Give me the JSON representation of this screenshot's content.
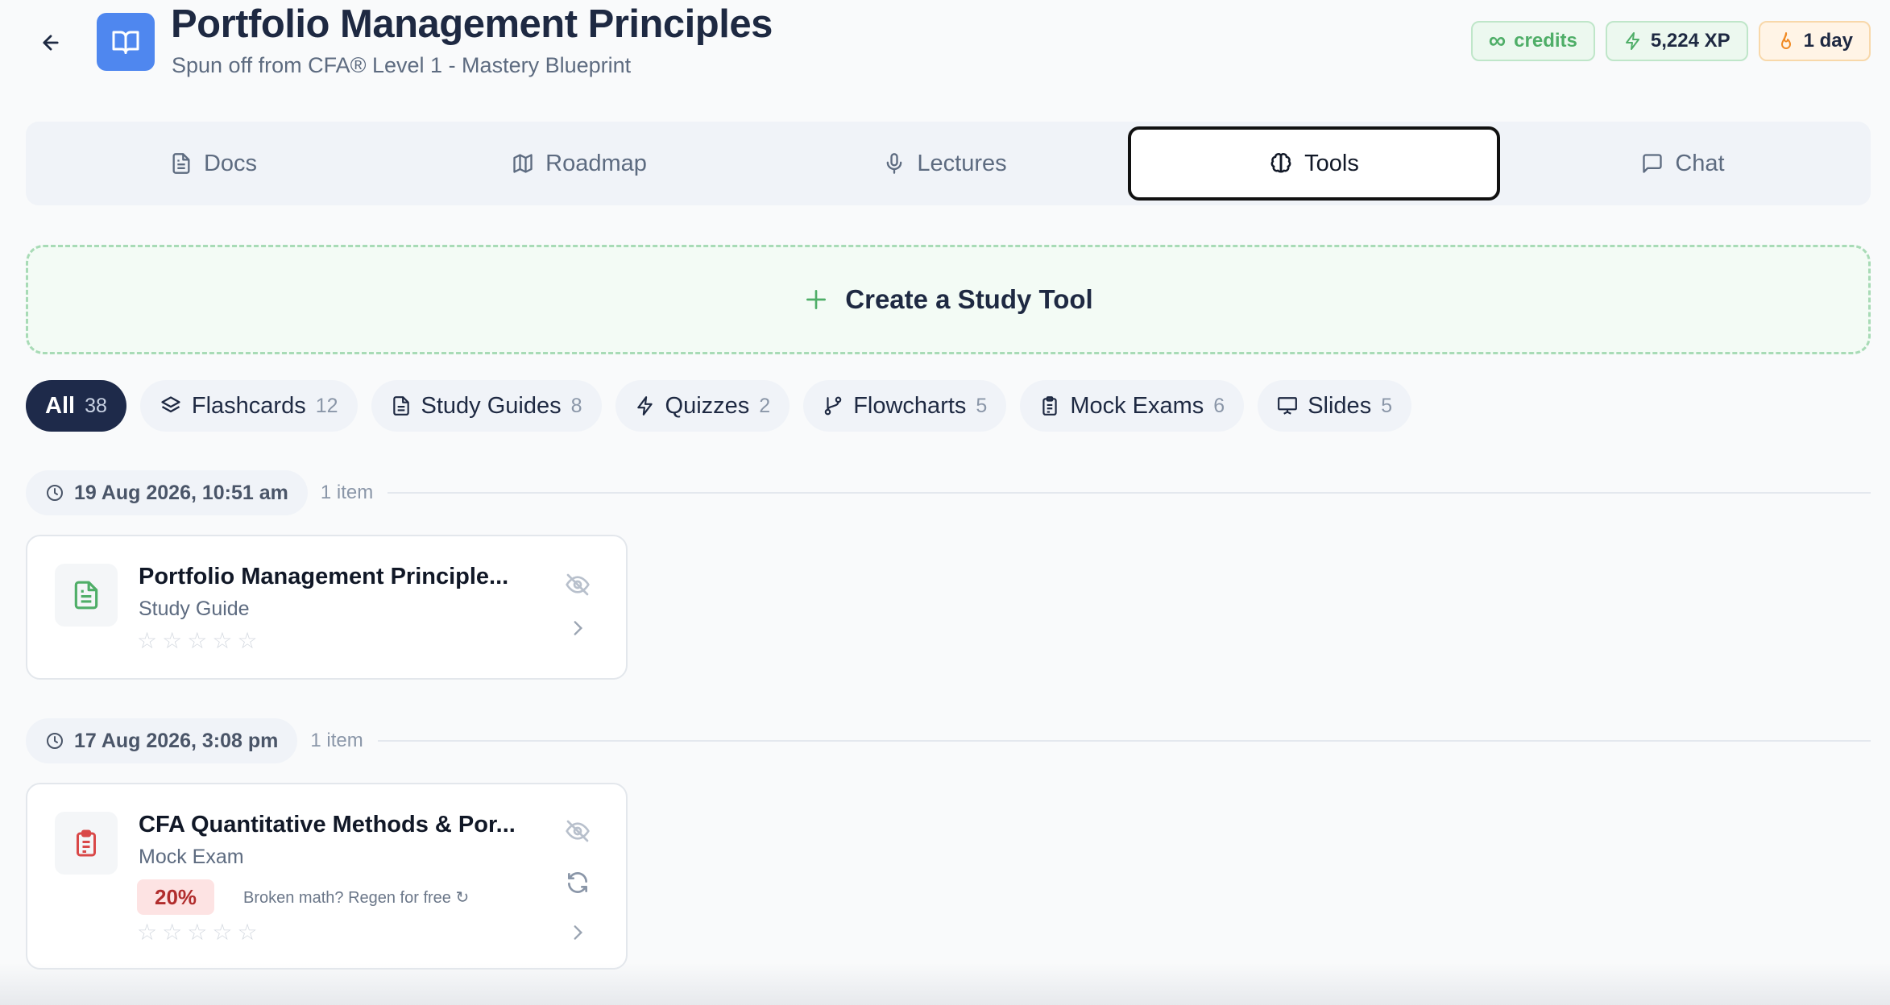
{
  "header": {
    "title": "Portfolio Management Principles",
    "subtitle": "Spun off from CFA® Level 1 - Mastery Blueprint"
  },
  "badges": {
    "credits_symbol": "∞",
    "credits_label": "credits",
    "xp": "5,224 XP",
    "streak": "1 day"
  },
  "tabs": [
    {
      "label": "Docs",
      "icon": "document-icon"
    },
    {
      "label": "Roadmap",
      "icon": "map-icon"
    },
    {
      "label": "Lectures",
      "icon": "microphone-icon"
    },
    {
      "label": "Tools",
      "icon": "brain-icon",
      "active": true
    },
    {
      "label": "Chat",
      "icon": "chat-icon"
    }
  ],
  "create": {
    "label": "Create a Study Tool"
  },
  "filters": [
    {
      "label": "All",
      "count": "38",
      "active": true
    },
    {
      "label": "Flashcards",
      "count": "12",
      "icon": "layers-icon"
    },
    {
      "label": "Study Guides",
      "count": "8",
      "icon": "document-icon"
    },
    {
      "label": "Quizzes",
      "count": "2",
      "icon": "lightning-icon"
    },
    {
      "label": "Flowcharts",
      "count": "5",
      "icon": "branch-icon"
    },
    {
      "label": "Mock Exams",
      "count": "6",
      "icon": "clipboard-icon"
    },
    {
      "label": "Slides",
      "count": "5",
      "icon": "presentation-icon"
    }
  ],
  "groups": [
    {
      "date": "19 Aug 2026, 10:51 am",
      "count": "1 item",
      "items": [
        {
          "title": "Portfolio Management Principle...",
          "type": "Study Guide",
          "rating": 0
        }
      ]
    },
    {
      "date": "17 Aug 2026, 3:08 pm",
      "count": "1 item",
      "items": [
        {
          "title": "CFA Quantitative Methods & Por...",
          "type": "Mock Exam",
          "score": "20%",
          "regen": "Broken math? Regen for free ↻",
          "rating": 0
        }
      ]
    }
  ],
  "colors": {
    "accent_navy": "#1e2a4a",
    "app_icon_blue": "#4f87ef",
    "success_green": "#4fae68",
    "danger_red": "#b12d2d"
  }
}
